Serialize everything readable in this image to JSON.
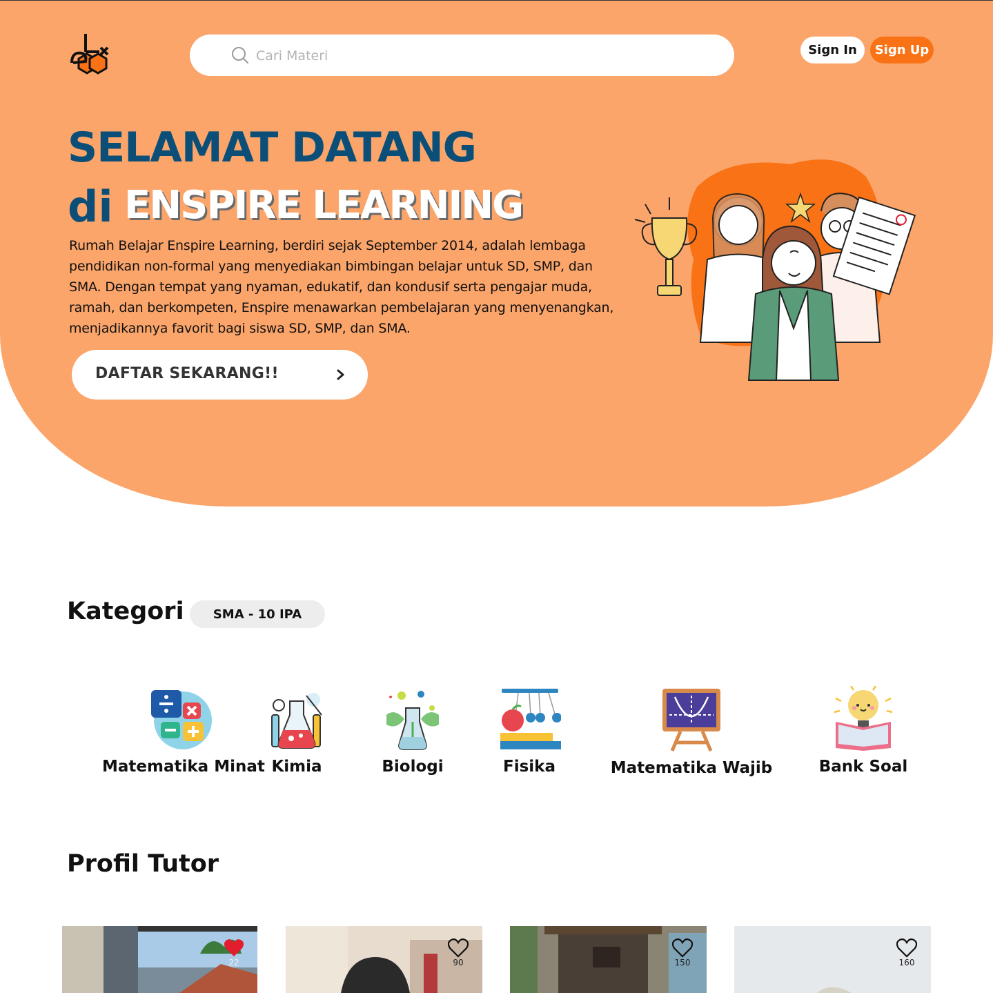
{
  "header": {
    "logo": "enspire-logo",
    "search": {
      "placeholder": "Cari Materi",
      "value": ""
    },
    "sign_in_label": "Sign In",
    "sign_up_label": "Sign Up"
  },
  "hero": {
    "title_line1": "SELAMAT DATANG",
    "title_di": "di",
    "title_brand": "ENSPIRE LEARNING",
    "description": "Rumah Belajar Enspire Learning, berdiri sejak September 2014, adalah lembaga pendidikan non-formal yang menyediakan bimbingan belajar untuk SD, SMP, dan SMA. Dengan tempat yang nyaman, edukatif, dan kondusif serta pengajar muda, ramah, dan berkompeten, Enspire menawarkan pembelajaran yang menyenangkan, menjadikannya favorit bagi siswa SD, SMP, dan SMA.",
    "cta_label": "DAFTAR SEKARANG!!",
    "cta_icon": "chevron-right-icon",
    "illustration": "students-celebrating-illustration"
  },
  "kategori": {
    "title": "Kategori",
    "level": "SMA - 10 IPA",
    "items": [
      {
        "label": "Matematika Minat",
        "icon": "math-operations-icon"
      },
      {
        "label": "Kimia",
        "icon": "chemistry-flask-icon"
      },
      {
        "label": "Biologi",
        "icon": "biology-plant-icon"
      },
      {
        "label": "Fisika",
        "icon": "newtons-cradle-icon"
      },
      {
        "label": "Matematika Wajib",
        "icon": "graph-board-icon"
      },
      {
        "label": "Bank Soal",
        "icon": "idea-book-icon"
      }
    ]
  },
  "tutor": {
    "title": "Profil Tutor",
    "cards": [
      {
        "likes": "22",
        "liked": true
      },
      {
        "likes": "90",
        "liked": false
      },
      {
        "likes": "150",
        "liked": false
      },
      {
        "likes": "160",
        "liked": false
      }
    ]
  },
  "colors": {
    "hero_bg": "#FBA56B",
    "accent": "#F97316",
    "title_blue": "#0B4F78",
    "liked": "#E11D2E"
  }
}
